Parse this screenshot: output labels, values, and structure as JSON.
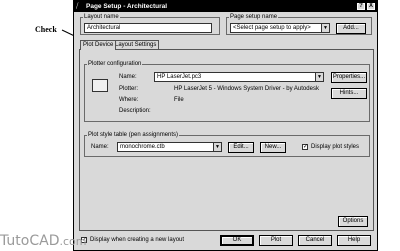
{
  "callout": {
    "text": "Check"
  },
  "dialog": {
    "title": "Page Setup - Architectural",
    "help_btn": "?",
    "close_btn": "X"
  },
  "layout_name": {
    "label": "Layout name",
    "value": "Architectural"
  },
  "page_setup_name": {
    "label": "Page setup name",
    "value": "<Select page setup to apply>",
    "add_button": "Add..."
  },
  "tabs": [
    {
      "label": "Plot Device"
    },
    {
      "label": "Layout Settings"
    }
  ],
  "plotter_config": {
    "label": "Plotter configuration",
    "name_label": "Name:",
    "name_value": "HP LaserJet.pc3",
    "plotter_label": "Plotter:",
    "plotter_value": "HP LaserJet 5 - Windows System Driver - by Autodesk",
    "where_label": "Where:",
    "where_value": "File",
    "description_label": "Description:",
    "properties_button": "Properties...",
    "hints_button": "Hints..."
  },
  "plot_style": {
    "label": "Plot style table (pen assignments)",
    "name_label": "Name:",
    "name_value": "monochrome.ctb",
    "edit_button": "Edit...",
    "new_button": "New...",
    "display_label": "Display plot styles",
    "display_checked": "✓"
  },
  "options_button": "Options",
  "footer": {
    "display_new_label": "Display when creating a new layout",
    "display_new_checked": "✓",
    "ok": "OK",
    "plot": "Plot",
    "cancel": "Cancel",
    "help": "Help"
  },
  "watermark": {
    "brand": "TutoCAD",
    "dot": ".com"
  }
}
